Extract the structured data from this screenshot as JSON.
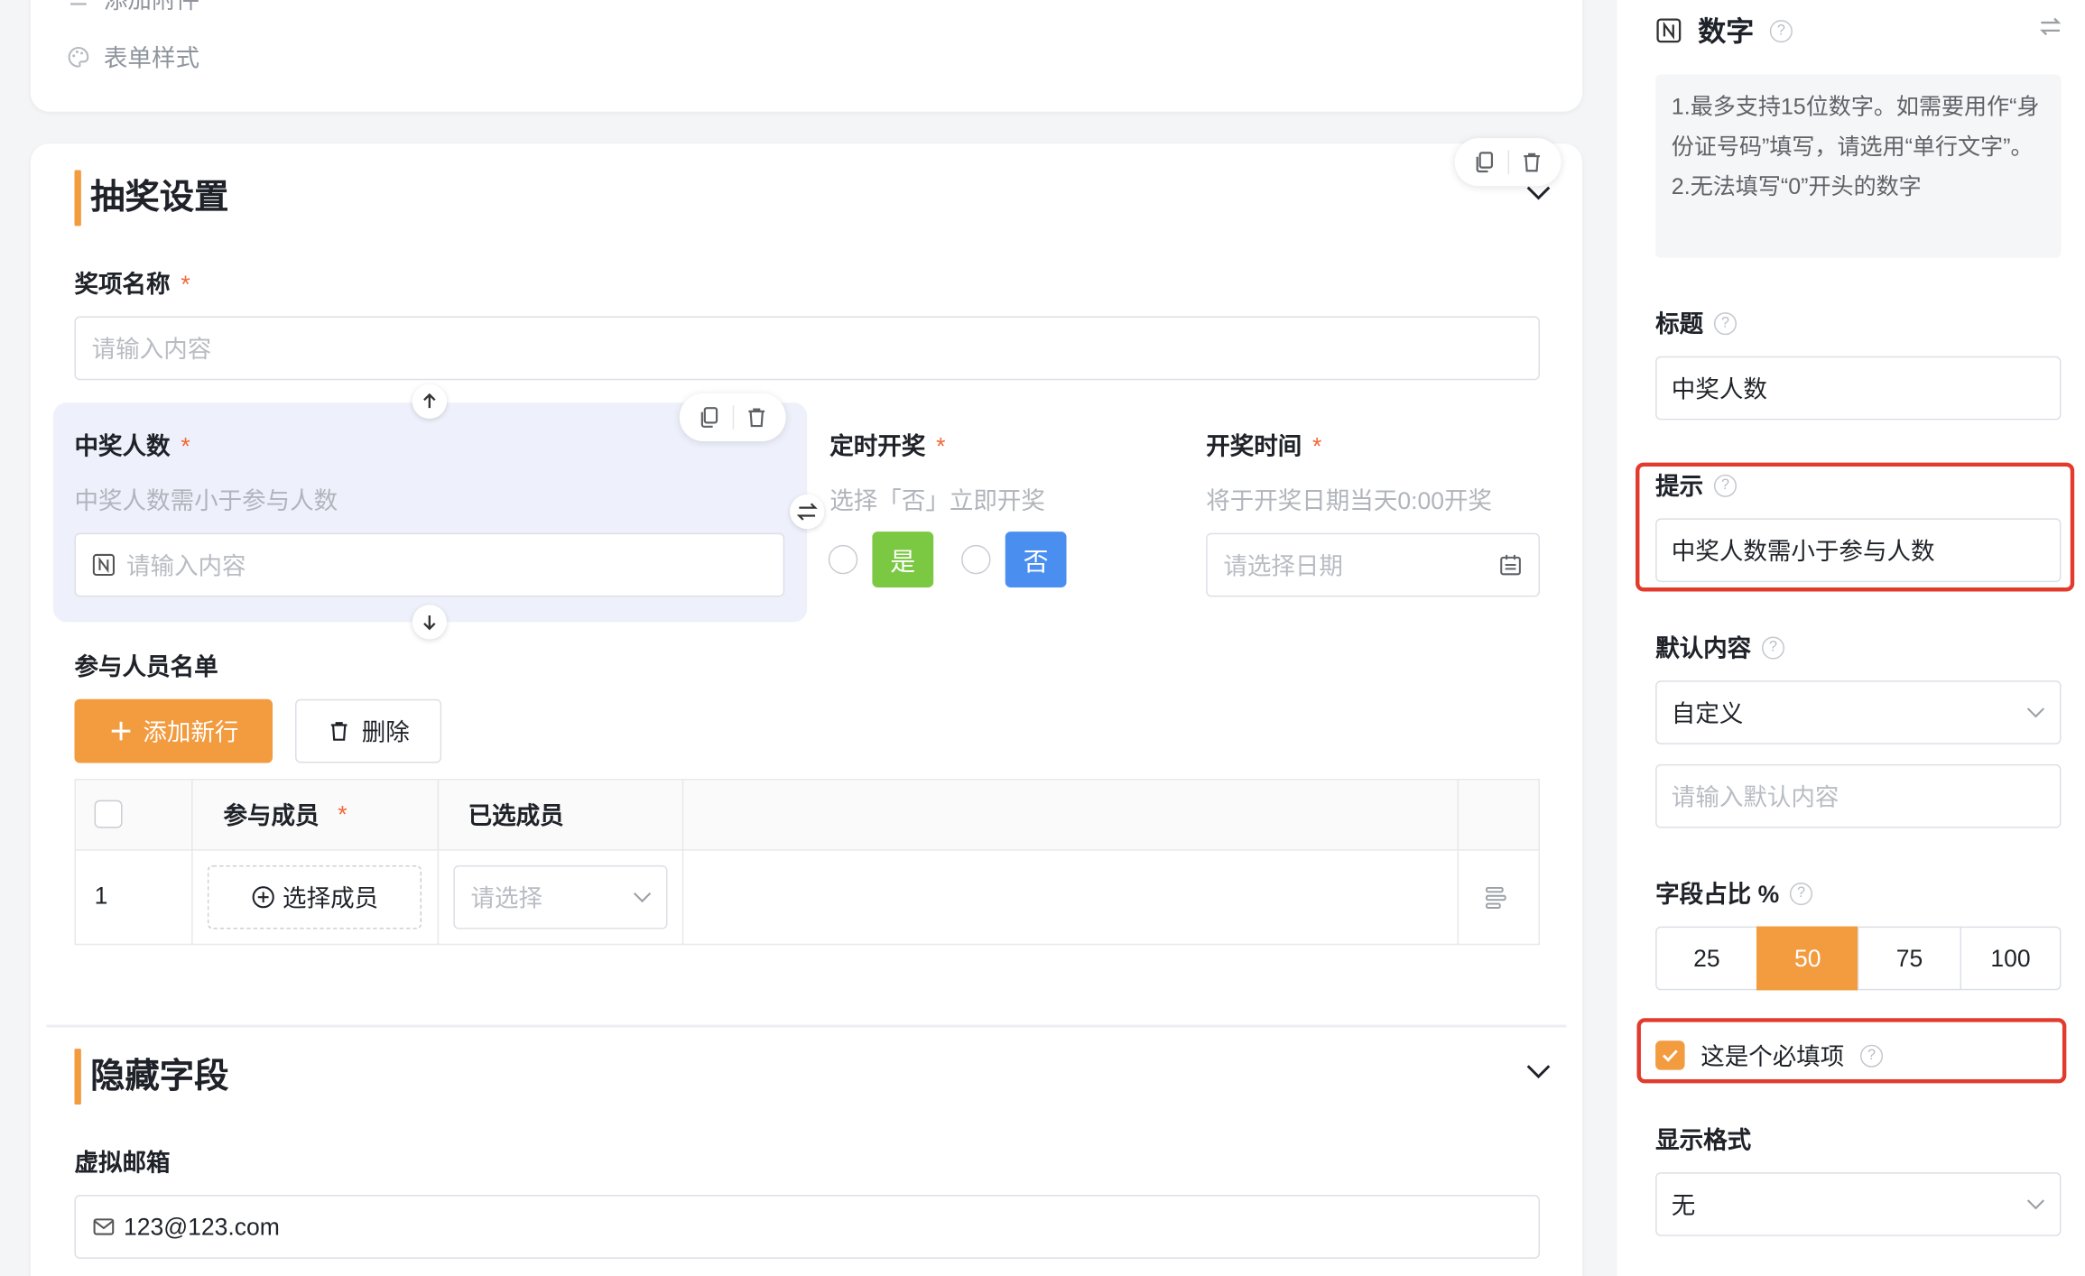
{
  "form_canvas": {
    "top_menu": {
      "add_attachment_label": "添加附件",
      "form_style_label": "表单样式"
    },
    "lottery_section": {
      "title": "抽奖设置",
      "prize_name": {
        "label": "奖项名称",
        "placeholder": "请输入内容"
      },
      "winners_count": {
        "label": "中奖人数",
        "hint": "中奖人数需小于参与人数",
        "placeholder": "请输入内容"
      },
      "timed_draw": {
        "label": "定时开奖",
        "hint": "选择「否」立即开奖",
        "yes_label": "是",
        "no_label": "否"
      },
      "draw_time": {
        "label": "开奖时间",
        "hint": "将于开奖日期当天0:00开奖",
        "placeholder": "请选择日期"
      },
      "participants": {
        "label": "参与人员名单",
        "add_row_label": "添加新行",
        "delete_label": "删除",
        "columns": [
          "参与成员",
          "已选成员"
        ],
        "rows": [
          {
            "index": "1",
            "select_member_label": "选择成员",
            "selected_placeholder": "请选择"
          }
        ]
      }
    },
    "hidden_section": {
      "title": "隐藏字段",
      "virtual_email": {
        "label": "虚拟邮箱",
        "value": "123@123.com"
      }
    },
    "required_mark": "*"
  },
  "properties_panel": {
    "field_type_title": "数字",
    "tips": [
      "1.最多支持15位数字。如需要用作“身份证号码”填写，请选用“单行文字”。",
      "2.无法填写“0”开头的数字"
    ],
    "title_label": "标题",
    "title_value": "中奖人数",
    "hint_label": "提示",
    "hint_value": "中奖人数需小于参与人数",
    "default_label": "默认内容",
    "default_select_value": "自定义",
    "default_input_placeholder": "请输入默认内容",
    "width_label": "字段占比 %",
    "width_options": [
      "25",
      "50",
      "75",
      "100"
    ],
    "width_selected": "50",
    "required_label": "这是个必填项",
    "required_checked": true,
    "format_label": "显示格式",
    "format_value": "无"
  },
  "colors": {
    "accent_orange": "#f29b3f",
    "yes_green": "#7bc843",
    "no_blue": "#4a8ef0",
    "highlight_red": "#e23b2e",
    "selected_field_bg": "#eef1fb"
  }
}
